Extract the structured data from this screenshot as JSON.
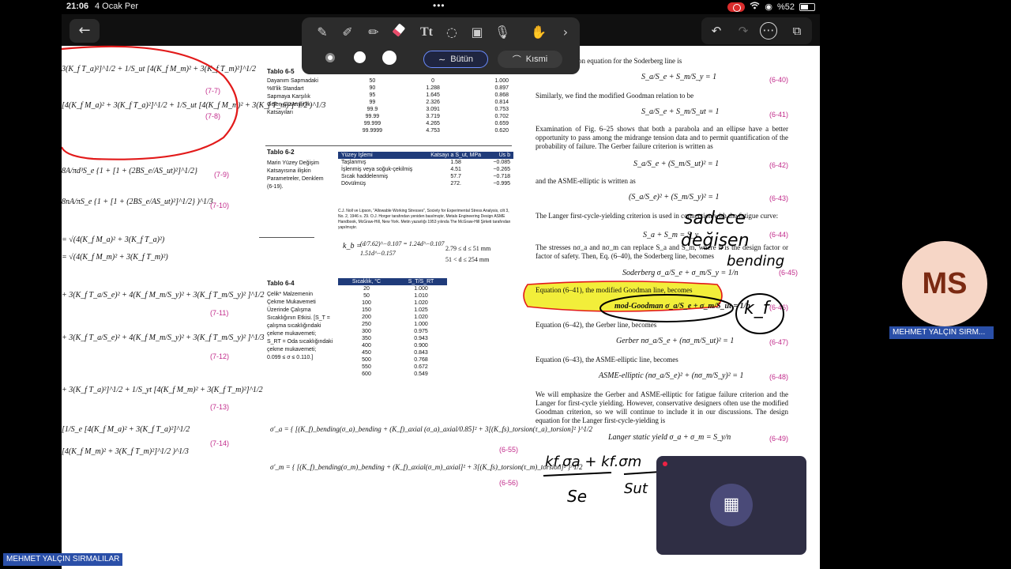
{
  "status_bar": {
    "time": "21:06",
    "date": "4 Ocak Per",
    "battery": "%52",
    "dots": "•••"
  },
  "toolbar": {
    "tools": [
      "pen-icon",
      "marker-icon",
      "highlighter-icon",
      "eraser-icon",
      "text-icon",
      "lasso-icon",
      "image-icon",
      "microphone-icon",
      "hand-icon",
      "chevron-right-icon"
    ],
    "active_tool": "eraser-icon",
    "erase_modes": {
      "whole": "Bütün",
      "partial": "Kısmi"
    },
    "selected_mode": "Bütün"
  },
  "nav": {
    "back": "←",
    "undo": "↶",
    "redo": "↷",
    "more": "⋯",
    "pages": "⧉"
  },
  "participant": {
    "initials": "MS",
    "name": "MEHMET YALÇIN SIRM...",
    "self_name": "MEHMET YALÇIN SIRMALILAR"
  },
  "left_eqs": [
    {
      "text": "3(K_f T_a)²]^1/2 + 1/S_ut [4(K_f M_m)² + 3(K_f T_m)²]^1/2",
      "num": "(7-7)"
    },
    {
      "text": "[4(K_f M_a)² + 3(K_f T_a)²]^1/2 + 1/S_ut [4(K_f M_m)² + 3(K_f T_m)²]^1/2 )^1/3",
      "num": "(7-8)"
    },
    {
      "text": "8A/πd³S_e {1 + [1 + (2BS_e/AS_ut)²]^1/2}",
      "num": "(7-9)"
    },
    {
      "text": "8nA/πS_e {1 + [1 + (2BS_e/AS_ut)²]^1/2} )^1/3",
      "num": "(7-10)"
    },
    {
      "text": "= √(4(K_f M_a)² + 3(K_f T_a)²)",
      "num": ""
    },
    {
      "text": "= √(4(K_f M_m)² + 3(K_f T_m)²)",
      "num": ""
    },
    {
      "text": "+ 3(K_f T_a/S_e)² + 4(K_f M_m/S_y)² + 3(K_f T_m/S_y)² ]^1/2",
      "num": "(7-11)"
    },
    {
      "text": "+ 3(K_f T_a/S_e)² + 4(K_f M_m/S_y)² + 3(K_f T_m/S_y)² ]^1/3",
      "num": "(7-12)"
    },
    {
      "text": "+ 3(K_f T_a)²]^1/2 + 1/S_yt [4(K_f M_m)² + 3(K_f T_m)²]^1/2",
      "num": "(7-13)"
    },
    {
      "text": "[1/S_e [4(K_f M_a)² + 3(K_f T_a)²]^1/2",
      "num": "(7-14)"
    },
    {
      "text": "[4(K_f M_m)² + 3(K_f T_m)²]^1/2 )^1/3",
      "num": ""
    }
  ],
  "table65": {
    "title": "Tablo 6-5",
    "caption": [
      "Dayanım Sapmadaki",
      "%8'lik Standart",
      "Sapmaya Karşılık",
      "Gelen Güvenilirlik",
      "Katsayıları"
    ],
    "rows": [
      [
        "50",
        "0",
        "1.000"
      ],
      [
        "90",
        "1.288",
        "0.897"
      ],
      [
        "95",
        "1.645",
        "0.868"
      ],
      [
        "99",
        "2.326",
        "0.814"
      ],
      [
        "99.9",
        "3.091",
        "0.753"
      ],
      [
        "99.99",
        "3.719",
        "0.702"
      ],
      [
        "99.999",
        "4.265",
        "0.659"
      ],
      [
        "99.9999",
        "4.753",
        "0.620"
      ]
    ]
  },
  "table62": {
    "title": "Tablo 6-2",
    "caption": [
      "Marin Yüzey Değişim",
      "Katsayısına ilişkin",
      "Parametreler, Denklem",
      "(6-19)."
    ],
    "headers": [
      "Yüzey İşlemi",
      "Katsayı a S_ut, MPa",
      "Üs b"
    ],
    "rows": [
      [
        "Taşlanmış",
        "1.58",
        "−0.085"
      ],
      [
        "İşlenmiş veya soğuk-çekilmiş",
        "4.51",
        "−0.265"
      ],
      [
        "Sıcak haddelenmiş",
        "57.7",
        "−0.718"
      ],
      [
        "Dövülmüş",
        "272.",
        "−0.995"
      ]
    ],
    "source": "C.J. Noll ve Lipson, \"Allowable Working Stresses\", Society for Experimental Stress Analysis, cilt 3, No. 2, 1946 s. 29. O.J. Horger tarafından yeniden basılmıştır, Metals Engineering Design ASME Handbook, McGraw-Hill, New York. Metin yazarlığı 1953 yılında The McGraw-Hill Şirketi tarafından yapılmıştır."
  },
  "kb_eq": {
    "lhs": "k_b =",
    "top": "(d/7.62)^−0.107 = 1.24d^−0.107",
    "bot": "1.51d^−0.157",
    "r1": "2.79 ≤ d ≤ 51 mm",
    "r2": "51 < d ≤ 254 mm"
  },
  "table64": {
    "title": "Tablo 6-4",
    "caption": [
      "Çelik* Malzemenin",
      "Çekme Mukavemeti",
      "Üzerinde Çalışma",
      "Sıcaklığının Etkisi. [S_T =",
      "çalışma sıcaklığındaki",
      "çekme mukavemeti;",
      "S_RT = Oda sıcaklığındaki",
      "çekme mukavemeti;",
      "0.099 ≤ σ ≤ 0.110.]"
    ],
    "headers": [
      "Sıcaklık, °C",
      "S_T/S_RT"
    ],
    "rows": [
      [
        "20",
        "1.000"
      ],
      [
        "50",
        "1.010"
      ],
      [
        "100",
        "1.020"
      ],
      [
        "150",
        "1.025"
      ],
      [
        "200",
        "1.020"
      ],
      [
        "250",
        "1.000"
      ],
      [
        "300",
        "0.975"
      ],
      [
        "350",
        "0.943"
      ],
      [
        "400",
        "0.900"
      ],
      [
        "450",
        "0.843"
      ],
      [
        "500",
        "0.768"
      ],
      [
        "550",
        "0.672"
      ],
      [
        "600",
        "0.549"
      ]
    ]
  },
  "sigma_eqs": [
    {
      "text": "σ'_a = { [(K_f)_bending(σ_a)_bending + (K_f)_axial (σ_a)_axial/0.85]² + 3[(K_fs)_torsion(τ_a)_torsion]² }^1/2",
      "num": "(6-55)"
    },
    {
      "text": "σ'_m = { [(K_f)_bending(σ_m)_bending + (K_f)_axial(σ_m)_axial]² + 3[(K_fs)_torsion(τ_m)_torsion]² }^1/2",
      "num": "(6-56)"
    }
  ],
  "right_col": {
    "line1": "on equation for the Soderberg line is",
    "eq_640": "S_a/S_e + S_m/S_y = 1",
    "num_640": "(6-40)",
    "similarly": "Similarly, we find the modified Goodman relation to be",
    "eq_641": "S_a/S_e + S_m/S_ut = 1",
    "num_641": "(6-41)",
    "para1": "Examination of Fig. 6–25 shows that both a parabola and an ellipse have a better opportunity to pass among the midrange tension data and to permit quantification of the probability of failure. The Gerber failure criterion is written as",
    "eq_642": "S_a/S_e + (S_m/S_ut)² = 1",
    "num_642": "(6-42)",
    "asme": "and the ASME-elliptic is written as",
    "eq_643": "(S_a/S_e)² + (S_m/S_y)² = 1",
    "num_643": "(6-43)",
    "langer": "The Langer first-cycle-yielding criterion is used in connection with the fatigue curve:",
    "eq_644": "S_a + S_m = S_y",
    "num_644": "(6-44)",
    "para2": "The stresses nσ_a and nσ_m can replace S_a and S_m, where n is the design factor or factor of safety. Then, Eq. (6–40), the Soderberg line, becomes",
    "soderberg": "Soderberg   σ_a/S_e + σ_m/S_y = 1/n",
    "num_645": "(6-45)",
    "eq641_text": "Equation (6–41), the modified Goodman line, becomes",
    "modgoodman": "mod-Goodman   σ_a/S_e + σ_m/S_ut = 1/n",
    "num_646": "(6-46)",
    "eq642_text": "Equation (6–42), the Gerber line, becomes",
    "gerber": "Gerber   nσ_a/S_e + (nσ_m/S_ut)² = 1",
    "num_647": "(6-47)",
    "eq643_text": "Equation (6–43), the ASME-elliptic line, becomes",
    "asme_eq": "ASME-elliptic   (nσ_a/S_e)² + (nσ_m/S_y)² = 1",
    "num_648": "(6-48)",
    "para3": "We will emphasize the Gerber and ASME-elliptic for fatigue failure criterion and the Langer for first-cycle yielding. However, conservative designers often use the modified Goodman criterion, so we will continue to include it in our discussions. The design equation for the Langer first-cycle-yielding is",
    "langer_eq": "Langer static yield   σ_a + σ_m = S_y/n",
    "num_649": "(6-49)"
  },
  "handwriting": {
    "w1": "sadece",
    "w2": "değişen",
    "w3": "bending",
    "kf": "k_f",
    "frac_num": "kf.σa + kf.σm",
    "frac_den1": "Se",
    "frac_den2": "Sut"
  },
  "float_panel": {
    "icon": "calendar-icon"
  }
}
